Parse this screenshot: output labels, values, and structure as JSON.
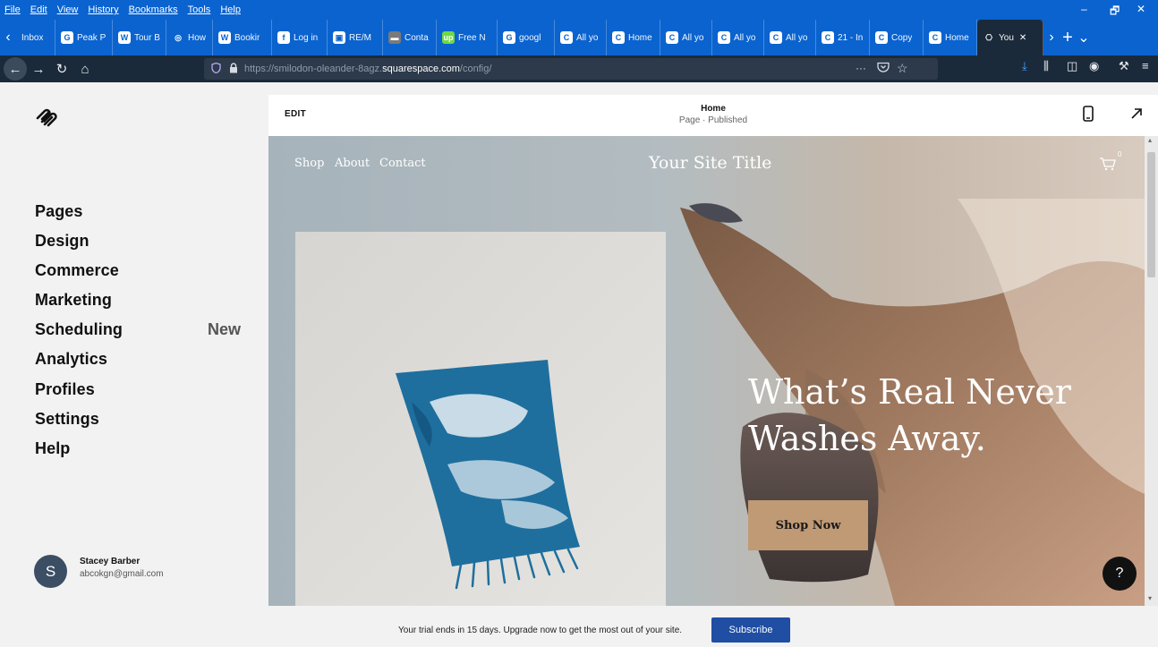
{
  "browser": {
    "menu": [
      "File",
      "Edit",
      "View",
      "History",
      "Bookmarks",
      "Tools",
      "Help"
    ],
    "window_controls": {
      "minimize": "–",
      "restore": "🗗",
      "close": "✕"
    },
    "tabs": [
      {
        "label": "Inbox",
        "icon": "mail-icon",
        "fav": "",
        "color": "#0a63cf"
      },
      {
        "label": "Peak P",
        "icon": "google-icon",
        "fav": "G",
        "color": "#ffffff"
      },
      {
        "label": "Tour B",
        "icon": "wordpress-icon",
        "fav": "W",
        "color": "#ffffff"
      },
      {
        "label": "How t",
        "icon": "globe-icon",
        "fav": "◎",
        "color": "#0a63cf"
      },
      {
        "label": "Bookir",
        "icon": "w-icon",
        "fav": "W",
        "color": "#ffffff"
      },
      {
        "label": "Log in",
        "icon": "facebook-icon",
        "fav": "f",
        "color": "#ffffff"
      },
      {
        "label": "RE/M",
        "icon": "remax-icon",
        "fav": "▣",
        "color": "#ffffff"
      },
      {
        "label": "Conta",
        "icon": "contact-icon",
        "fav": "▬",
        "color": "#7a7a7a"
      },
      {
        "label": "Free N",
        "icon": "upwork-icon",
        "fav": "up",
        "color": "#6fda44"
      },
      {
        "label": "googl",
        "icon": "google-icon",
        "fav": "G",
        "color": "#ffffff"
      },
      {
        "label": "All yo",
        "icon": "c-icon",
        "fav": "C",
        "color": "#ffffff"
      },
      {
        "label": "Home",
        "icon": "c-icon",
        "fav": "C",
        "color": "#ffffff"
      },
      {
        "label": "All yo",
        "icon": "c-icon",
        "fav": "C",
        "color": "#ffffff"
      },
      {
        "label": "All yo",
        "icon": "c-icon",
        "fav": "C",
        "color": "#ffffff"
      },
      {
        "label": "All yo",
        "icon": "c-icon",
        "fav": "C",
        "color": "#ffffff"
      },
      {
        "label": "21 - In",
        "icon": "c-icon",
        "fav": "C",
        "color": "#ffffff"
      },
      {
        "label": "Copy",
        "icon": "c-icon",
        "fav": "C",
        "color": "#ffffff"
      },
      {
        "label": "Home",
        "icon": "c-icon",
        "fav": "C",
        "color": "#ffffff"
      },
      {
        "label": "You",
        "icon": "squarespace-icon",
        "fav": "⎔",
        "color": "#1b2a3a",
        "active": true
      }
    ],
    "tab_scroll_left": "‹",
    "tab_scroll_right": "›",
    "new_tab": "+",
    "tab_overflow": "⌄",
    "url_prefix": "https://smilodon-oleander-8agz.",
    "url_host": "squarespace.com",
    "url_path": "/config/",
    "page_actions": "···",
    "nav": {
      "back": "←",
      "forward": "→",
      "reload": "↻",
      "home": "⌂"
    }
  },
  "sidebar": {
    "items": [
      {
        "label": "Pages"
      },
      {
        "label": "Design"
      },
      {
        "label": "Commerce"
      },
      {
        "label": "Marketing"
      },
      {
        "label": "Scheduling",
        "badge": "New"
      },
      {
        "label": "Analytics"
      },
      {
        "label": "Profiles"
      },
      {
        "label": "Settings"
      },
      {
        "label": "Help"
      }
    ],
    "user": {
      "initial": "S",
      "name": "Stacey Barber",
      "email": "abcokgn@gmail.com"
    }
  },
  "editor": {
    "edit_label": "EDIT",
    "page_title": "Home",
    "page_status": "Page · Published"
  },
  "site": {
    "nav": [
      "Shop",
      "About",
      "Contact"
    ],
    "title": "Your Site Title",
    "cart_count": "0",
    "hero_heading_line1": "What’s Real Never",
    "hero_heading_line2": "Washes Away.",
    "cta": "Shop Now",
    "help": "?"
  },
  "banner": {
    "text": "Your trial ends in 15 days. Upgrade now to get the most out of your site.",
    "button": "Subscribe"
  },
  "colors": {
    "browser_blue": "#0a63cf",
    "toolbar_dark": "#1b2a3a",
    "cta_tan": "#c09a74",
    "subscribe_blue": "#1f4ea3"
  }
}
